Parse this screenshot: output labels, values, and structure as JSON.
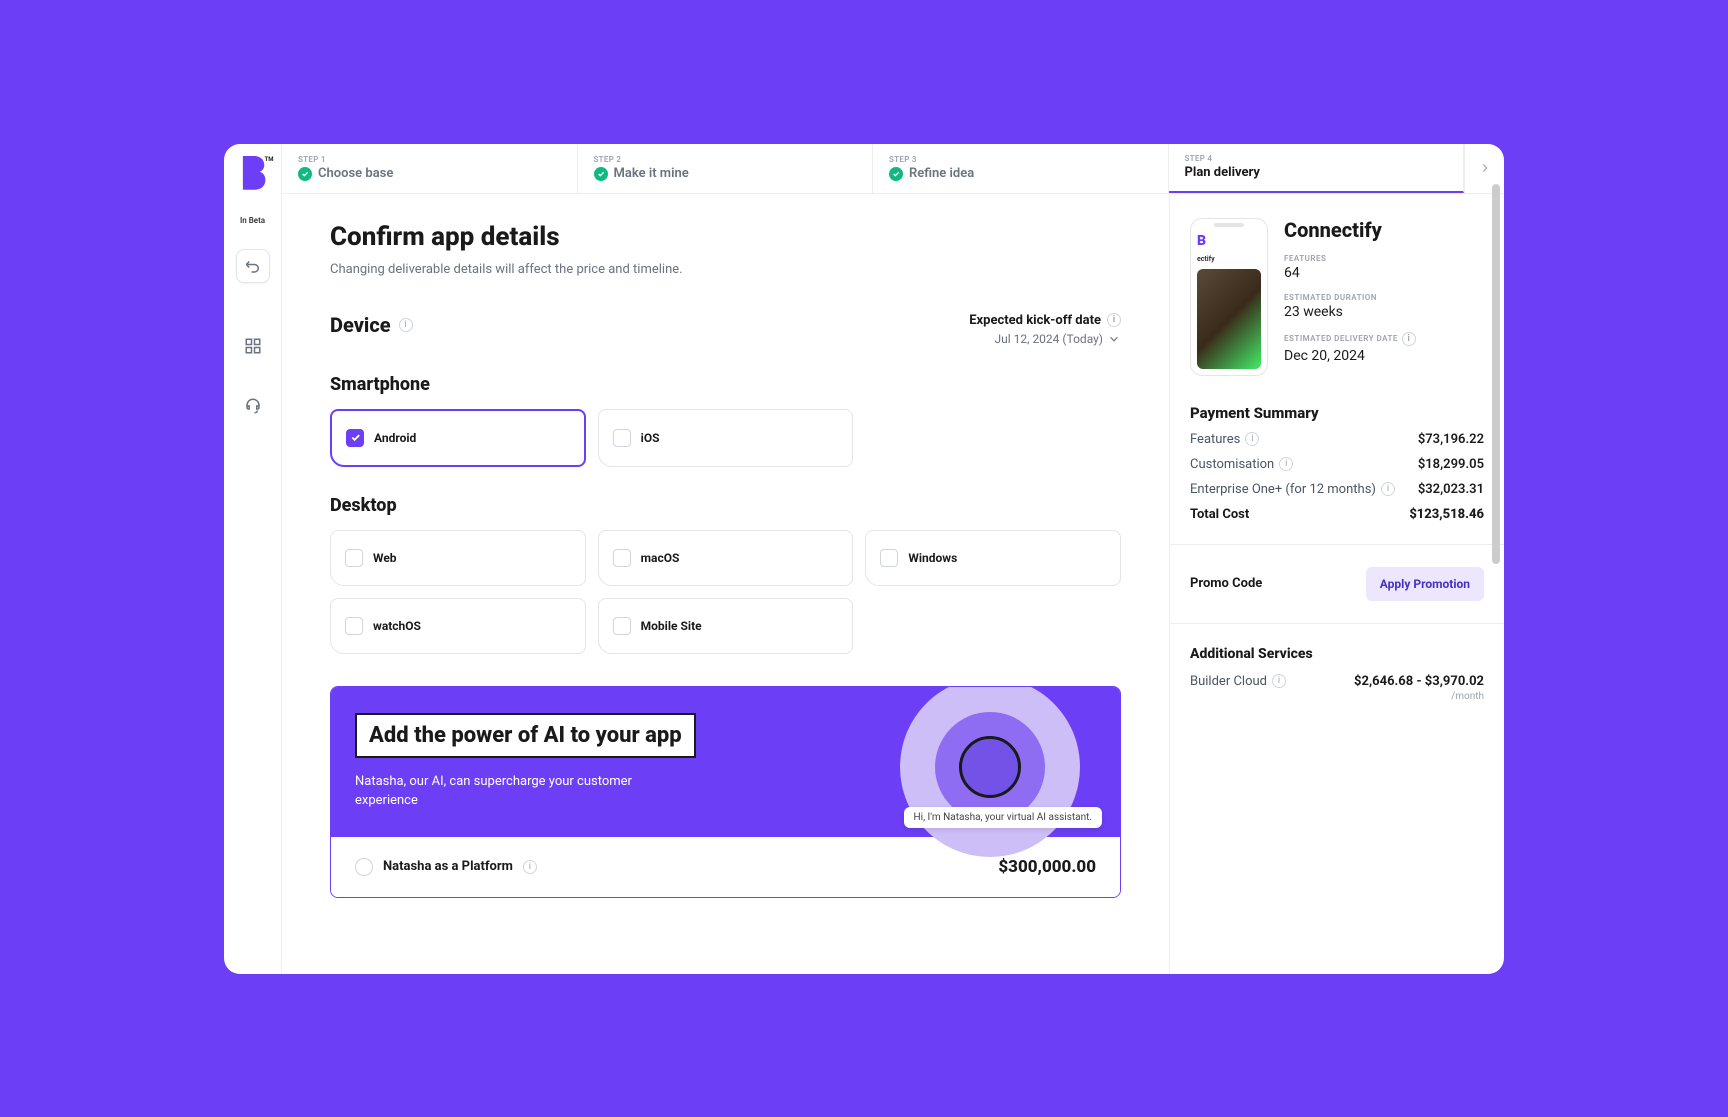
{
  "brand": {
    "in_beta": "In Beta"
  },
  "stepper": {
    "steps": [
      {
        "num": "STEP 1",
        "label": "Choose base",
        "done": true,
        "active": false
      },
      {
        "num": "STEP 2",
        "label": "Make it mine",
        "done": true,
        "active": false
      },
      {
        "num": "STEP 3",
        "label": "Refine idea",
        "done": true,
        "active": false
      },
      {
        "num": "STEP 4",
        "label": "Plan delivery",
        "done": false,
        "active": true
      }
    ]
  },
  "page": {
    "title": "Confirm app details",
    "subtitle": "Changing deliverable details will affect the price and timeline.",
    "device_heading": "Device",
    "kickoff_label": "Expected kick-off date",
    "kickoff_date": "Jul 12, 2024 (Today)",
    "smartphone_heading": "Smartphone",
    "desktop_heading": "Desktop",
    "smartphone_options": [
      {
        "label": "Android",
        "selected": true
      },
      {
        "label": "iOS",
        "selected": false
      }
    ],
    "desktop_options": [
      {
        "label": "Web",
        "selected": false
      },
      {
        "label": "macOS",
        "selected": false
      },
      {
        "label": "Windows",
        "selected": false
      },
      {
        "label": "watchOS",
        "selected": false
      },
      {
        "label": "Mobile Site",
        "selected": false
      }
    ]
  },
  "ai": {
    "title": "Add the power of AI to your app",
    "subtitle": "Natasha, our AI, can supercharge your customer experience",
    "speech": "Hi, I'm Natasha, your virtual AI assistant.",
    "platform_label": "Natasha as a Platform",
    "platform_price": "$300,000.00"
  },
  "summary": {
    "app_name": "Connectify",
    "phone_app_title": "ectify",
    "fields": {
      "features_label": "FEATURES",
      "features_val": "64",
      "duration_label": "ESTIMATED DURATION",
      "duration_val": "23 weeks",
      "delivery_label": "ESTIMATED DELIVERY DATE",
      "delivery_val": "Dec 20, 2024"
    },
    "payment_title": "Payment Summary",
    "rows": [
      {
        "label": "Features",
        "val": "$73,196.22",
        "info": true
      },
      {
        "label": "Customisation",
        "val": "$18,299.05",
        "info": true
      },
      {
        "label": "Enterprise One+ (for 12 months)",
        "val": "$32,023.31",
        "info": true
      }
    ],
    "total_label": "Total Cost",
    "total_val": "$123,518.46",
    "promo_label": "Promo Code",
    "promo_btn": "Apply Promotion",
    "additional_title": "Additional Services",
    "builder_cloud_label": "Builder Cloud",
    "builder_cloud_price": "$2,646.68 - $3,970.02",
    "builder_cloud_unit": "/month"
  }
}
